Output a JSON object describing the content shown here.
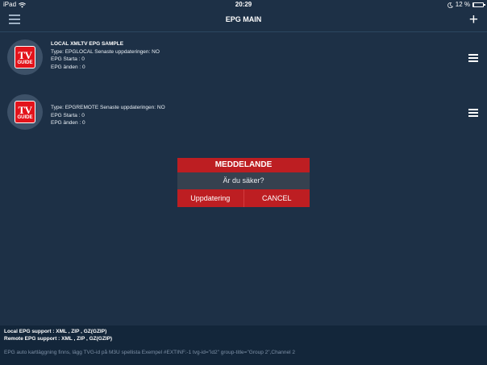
{
  "status_bar": {
    "device": "iPad",
    "wifi_icon": "wifi-icon",
    "time": "20:29",
    "moon_icon": "moon-icon",
    "battery_text": "12 %",
    "battery_level": 0.12
  },
  "nav": {
    "title": "EPG MAIN",
    "menu_icon": "hamburger-icon",
    "add_icon": "plus-icon",
    "add_glyph": "+"
  },
  "epg_items": [
    {
      "logo": {
        "line1": "TV",
        "line2": "GUIDE"
      },
      "name": "LOCAL XMLTV EPG SAMPLE",
      "type_line": "Type: EPGLOCAL Senaste uppdateringen: NO",
      "start_line": "EPG Starta : 0",
      "end_line": "EPG änden : 0"
    },
    {
      "logo": {
        "line1": "TV",
        "line2": "GUIDE"
      },
      "name": "",
      "type_line": "Type: EPGREMOTE Senaste uppdateringen: NO",
      "start_line": "EPG Starta : 0",
      "end_line": "EPG änden : 0"
    }
  ],
  "dialog": {
    "title": "MEDDELANDE",
    "message": "Är du säker?",
    "confirm_label": "Uppdatering",
    "cancel_label": "CANCEL"
  },
  "footer": {
    "local_support": "Local EPG support : XML , ZIP , GZ(GZIP)",
    "remote_support": "Remote EPG support : XML , ZIP , GZ(GZIP)",
    "note": "EPG auto kartläggning finns, lägg TVG-id på M3U spellista Exempel #EXTINF:-1 tvg-id=\"id2\" group-title=\"Group 2\",Channel 2"
  },
  "colors": {
    "background": "#1d3046",
    "dialog_accent": "#bd1e22",
    "dialog_body": "#36414f",
    "footer_background": "#13263a",
    "logo_red": "#e3131b"
  }
}
